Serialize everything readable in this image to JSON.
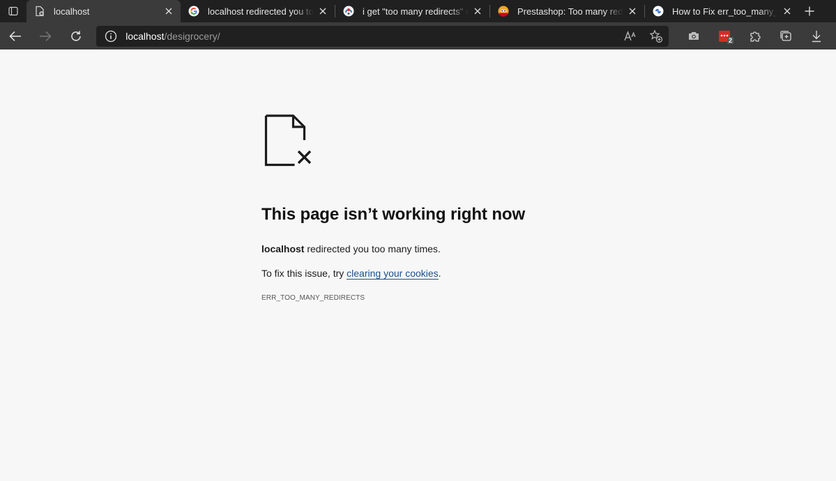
{
  "tabs": [
    {
      "title": "localhost",
      "favicon": "broken-page-icon",
      "active": true
    },
    {
      "title": "localhost redirected you too many times",
      "favicon": "google-icon",
      "active": false
    },
    {
      "title": "i get \"too many redirects\" error",
      "favicon": "forum-icon",
      "active": false
    },
    {
      "title": "Prestashop: Too many redirects",
      "favicon": "prestashop-icon",
      "active": false
    },
    {
      "title": "How to Fix err_too_many_redirects",
      "favicon": "link-icon",
      "active": false
    }
  ],
  "address": {
    "host": "localhost",
    "path": "/desigrocery/"
  },
  "extension_badge": "2",
  "error": {
    "heading": "This page isn’t working right now",
    "host": "localhost",
    "message": " redirected you too many times.",
    "fix_prefix": "To fix this issue, try ",
    "fix_link": "clearing your cookies",
    "fix_suffix": ".",
    "code": "ERR_TOO_MANY_REDIRECTS"
  },
  "colors": {
    "chrome_bg": "#202020",
    "toolbar_bg": "#3b3b3b",
    "page_bg": "#f7f7f7",
    "link": "#1d4f85"
  }
}
